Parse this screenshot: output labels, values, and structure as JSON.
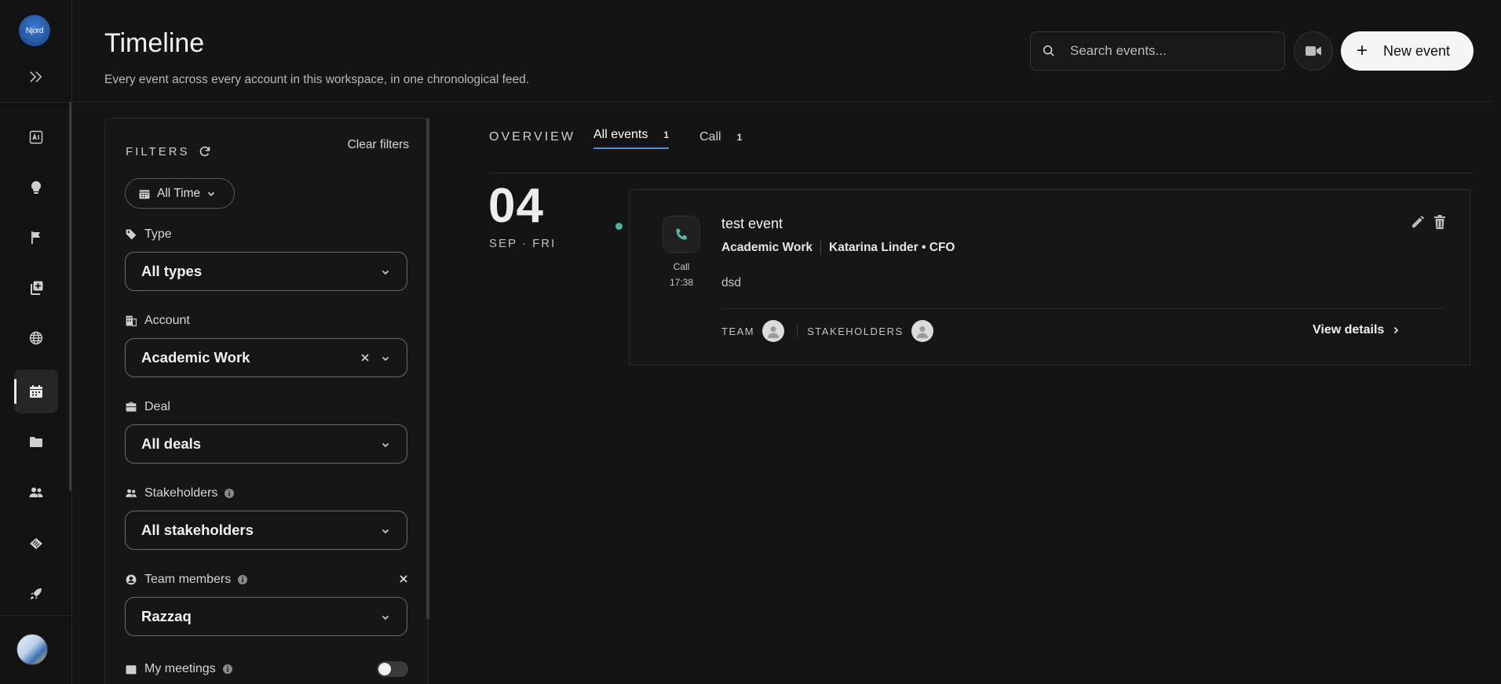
{
  "app": {
    "logo_text": "Njord"
  },
  "header": {
    "title": "Timeline",
    "subtitle": "Every event across every account in this workspace, in one chronological feed.",
    "search_placeholder": "Search events...",
    "new_event_label": "New event"
  },
  "sidebar": {
    "items": [
      {
        "icon": "ai-icon"
      },
      {
        "icon": "lightbulb-icon"
      },
      {
        "icon": "flag-icon"
      },
      {
        "icon": "add-box-icon"
      },
      {
        "icon": "globe-icon"
      },
      {
        "icon": "calendar-icon",
        "active": true
      },
      {
        "icon": "folder-icon"
      },
      {
        "icon": "people-icon"
      },
      {
        "icon": "handshake-icon"
      },
      {
        "icon": "rocket-icon"
      }
    ]
  },
  "filters": {
    "title": "FILTERS",
    "clear_label": "Clear filters",
    "time_range": "All Time",
    "type": {
      "label": "Type",
      "value": "All types"
    },
    "account": {
      "label": "Account",
      "value": "Academic Work"
    },
    "deal": {
      "label": "Deal",
      "value": "All deals"
    },
    "stakeholders": {
      "label": "Stakeholders",
      "value": "All stakeholders"
    },
    "team_members": {
      "label": "Team members",
      "value": "Razzaq"
    },
    "my_meetings": {
      "label": "My meetings",
      "enabled": false
    }
  },
  "tabs": {
    "overview_label": "OVERVIEW",
    "items": [
      {
        "label": "All events",
        "count": "1",
        "active": true
      },
      {
        "label": "Call",
        "count": "1",
        "active": false
      }
    ]
  },
  "timeline": {
    "date": {
      "day": "04",
      "sub": "SEP · FRI"
    },
    "dot_color": "#4fb3a0",
    "event": {
      "type_label": "Call",
      "time": "17:38",
      "title": "test event",
      "account": "Academic Work",
      "contact": "Katarina Linder • CFO",
      "description": "dsd",
      "team_label": "TEAM",
      "stakeholders_label": "STAKEHOLDERS",
      "view_details_label": "View details"
    }
  },
  "colors": {
    "background": "#141414",
    "accent": "#4a90d9",
    "call_icon": "#5fb8a6"
  }
}
